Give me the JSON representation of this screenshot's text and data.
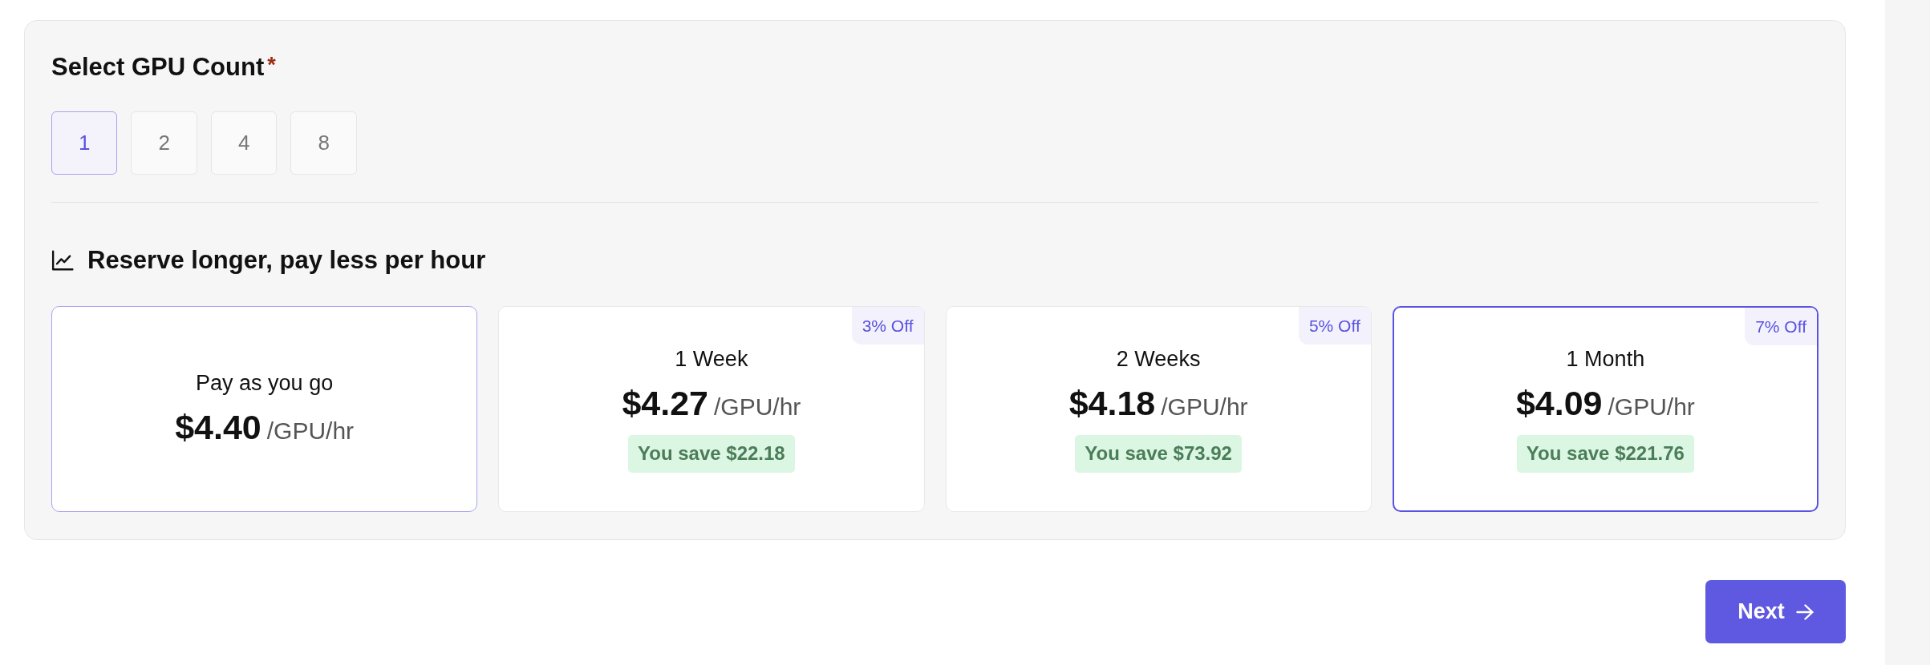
{
  "gpu_count": {
    "title": "Select GPU Count",
    "required_mark": "*",
    "options": [
      {
        "label": "1",
        "selected": true
      },
      {
        "label": "2",
        "selected": false
      },
      {
        "label": "4",
        "selected": false
      },
      {
        "label": "8",
        "selected": false
      }
    ]
  },
  "pricing": {
    "heading": "Reserve longer, pay less per hour",
    "plans": [
      {
        "name": "Pay as you go",
        "price": "$4.40",
        "unit": "/GPU/hr",
        "selected": true,
        "hovered": false
      },
      {
        "name": "1 Week",
        "price": "$4.27",
        "unit": "/GPU/hr",
        "discount": "3% Off",
        "savings": "You save $22.18",
        "selected": false,
        "hovered": false
      },
      {
        "name": "2 Weeks",
        "price": "$4.18",
        "unit": "/GPU/hr",
        "discount": "5% Off",
        "savings": "You save $73.92",
        "selected": false,
        "hovered": false
      },
      {
        "name": "1 Month",
        "price": "$4.09",
        "unit": "/GPU/hr",
        "discount": "7% Off",
        "savings": "You save $221.76",
        "selected": false,
        "hovered": true
      }
    ]
  },
  "next_button": {
    "label": "Next"
  }
}
